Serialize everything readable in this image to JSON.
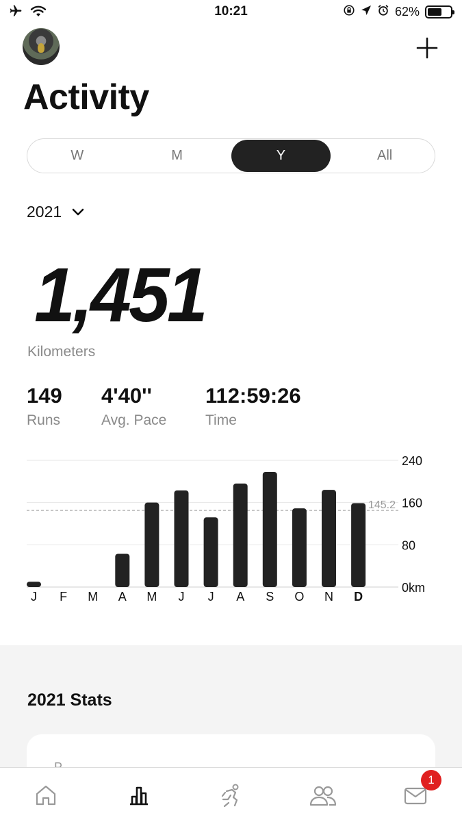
{
  "status_bar": {
    "time": "10:21",
    "battery": "62%",
    "battery_level": 0.62,
    "left_icons": [
      "airplane-icon",
      "wifi-icon"
    ],
    "right_icons": [
      "orientation-lock-icon",
      "location-icon",
      "alarm-icon"
    ]
  },
  "header": {
    "title": "Activity",
    "add_icon": "plus-icon"
  },
  "segments": [
    {
      "label": "W",
      "active": false
    },
    {
      "label": "M",
      "active": false
    },
    {
      "label": "Y",
      "active": true
    },
    {
      "label": "All",
      "active": false
    }
  ],
  "year_selector": {
    "value": "2021"
  },
  "summary": {
    "distance": "1,451",
    "distance_unit": "Kilometers",
    "stats": [
      {
        "value": "149",
        "label": "Runs"
      },
      {
        "value": "4'40''",
        "label": "Avg. Pace"
      },
      {
        "value": "112:59:26",
        "label": "Time"
      }
    ]
  },
  "chart_data": {
    "type": "bar",
    "categories": [
      "J",
      "F",
      "M",
      "A",
      "M",
      "J",
      "J",
      "A",
      "S",
      "O",
      "N",
      "D"
    ],
    "values": [
      10,
      0,
      0,
      63,
      160,
      183,
      132,
      196,
      218,
      149,
      184,
      159
    ],
    "ylim": [
      0,
      240
    ],
    "yticks": [
      "240",
      "160",
      "80",
      "0km"
    ],
    "ytick_values": [
      240,
      160,
      80,
      0
    ],
    "average_value": 145.2,
    "average_label": "145.2",
    "highlight_category_index": 11,
    "grid": true
  },
  "stats_section": {
    "title": "2021 Stats",
    "card_peek": "P"
  },
  "tab_bar": {
    "tabs": [
      "home-icon",
      "activity-chart-icon",
      "run-icon",
      "club-icon",
      "inbox-icon"
    ],
    "active_index": 1,
    "inbox_badge": "1"
  }
}
